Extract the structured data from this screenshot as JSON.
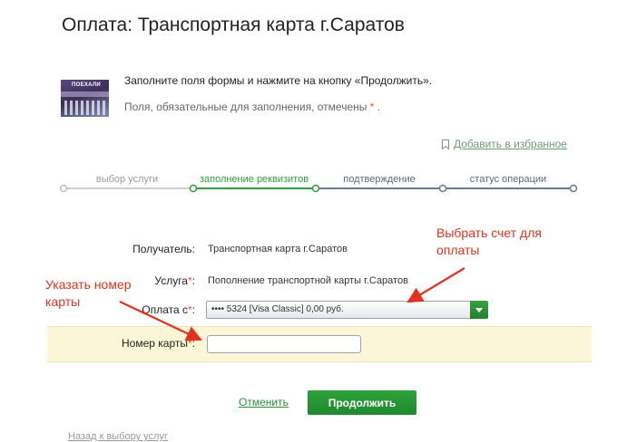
{
  "page": {
    "title": "Оплата: Транспортная карта г.Саратов"
  },
  "card_image": {
    "label": "ПОЕХАЛИ"
  },
  "instructions": {
    "fill_text": "Заполните поля формы и нажмите на кнопку «Продолжить».",
    "required_text": "Поля, обязательные для заполнения, отмечены",
    "required_star": "*",
    "required_end": "."
  },
  "favorites": {
    "label": "Добавить в избранное",
    "icon": "bookmark-icon"
  },
  "steps": [
    {
      "label": "выбор услуги",
      "state": "done"
    },
    {
      "label": "заполнение реквизитов",
      "state": "current"
    },
    {
      "label": "подтверждение",
      "state": "todo"
    },
    {
      "label": "статус операции",
      "state": "todo"
    }
  ],
  "form": {
    "recipient": {
      "label": "Получатель:",
      "value": "Транспортная карта г.Саратов"
    },
    "service": {
      "label": "Услуга",
      "star": "*",
      "colon": ":",
      "value": "Пополнение транспортной карты г.Саратов"
    },
    "pay_from": {
      "label": "Оплата с",
      "star": "*",
      "colon": ":",
      "selected": "•••• 5324 [Visa Classic] 0,00 руб."
    },
    "card_number": {
      "label": "Номер карты",
      "star": "*",
      "colon": ":",
      "value": "",
      "placeholder": ""
    }
  },
  "actions": {
    "cancel": "Отменить",
    "continue": "Продолжить",
    "back": "Назад к выбору услуг"
  },
  "annotations": {
    "choose_account": [
      "Выбрать счет для",
      "оплаты"
    ],
    "enter_card": [
      "Указать номер",
      "карты"
    ]
  },
  "colors": {
    "accent_green": "#2f9e3f",
    "annotation_red": "#e0321e",
    "required_star": "#e05a2b",
    "highlight_row": "#fbf6d7"
  }
}
